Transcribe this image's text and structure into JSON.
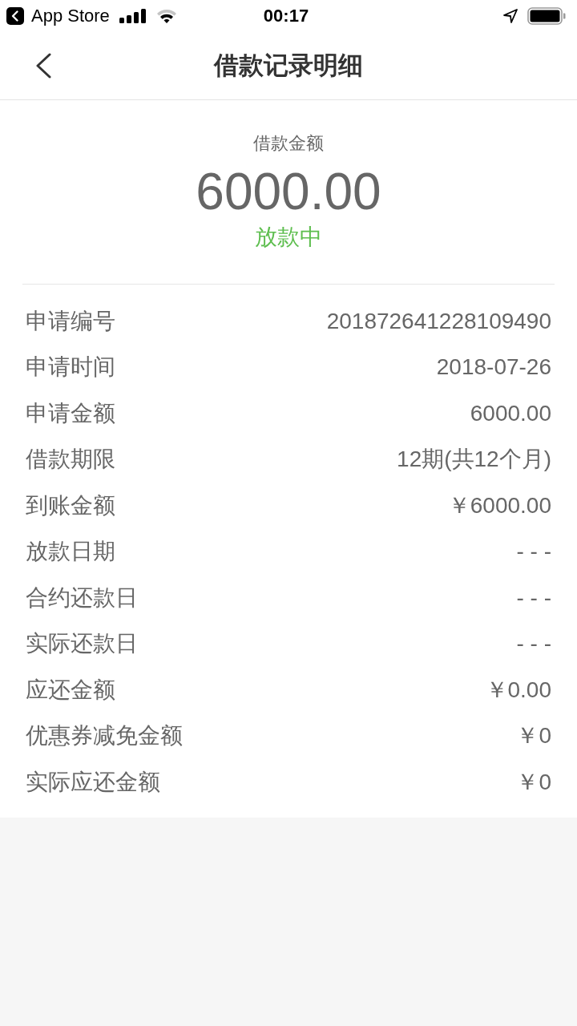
{
  "status_bar": {
    "back_app": "App Store",
    "time": "00:17"
  },
  "nav": {
    "title": "借款记录明细"
  },
  "summary": {
    "label": "借款金额",
    "amount": "6000.00",
    "status": "放款中"
  },
  "details": [
    {
      "label": "申请编号",
      "value": "201872641228109490"
    },
    {
      "label": "申请时间",
      "value": "2018-07-26"
    },
    {
      "label": "申请金额",
      "value": "6000.00"
    },
    {
      "label": "借款期限",
      "value": "12期(共12个月)"
    },
    {
      "label": "到账金额",
      "value": "￥6000.00"
    },
    {
      "label": "放款日期",
      "value": "- - -"
    },
    {
      "label": "合约还款日",
      "value": "- - -"
    },
    {
      "label": "实际还款日",
      "value": "- - -"
    },
    {
      "label": "应还金额",
      "value": "￥0.00"
    },
    {
      "label": "优惠券减免金额",
      "value": "￥0"
    },
    {
      "label": "实际应还金额",
      "value": "￥0"
    }
  ]
}
